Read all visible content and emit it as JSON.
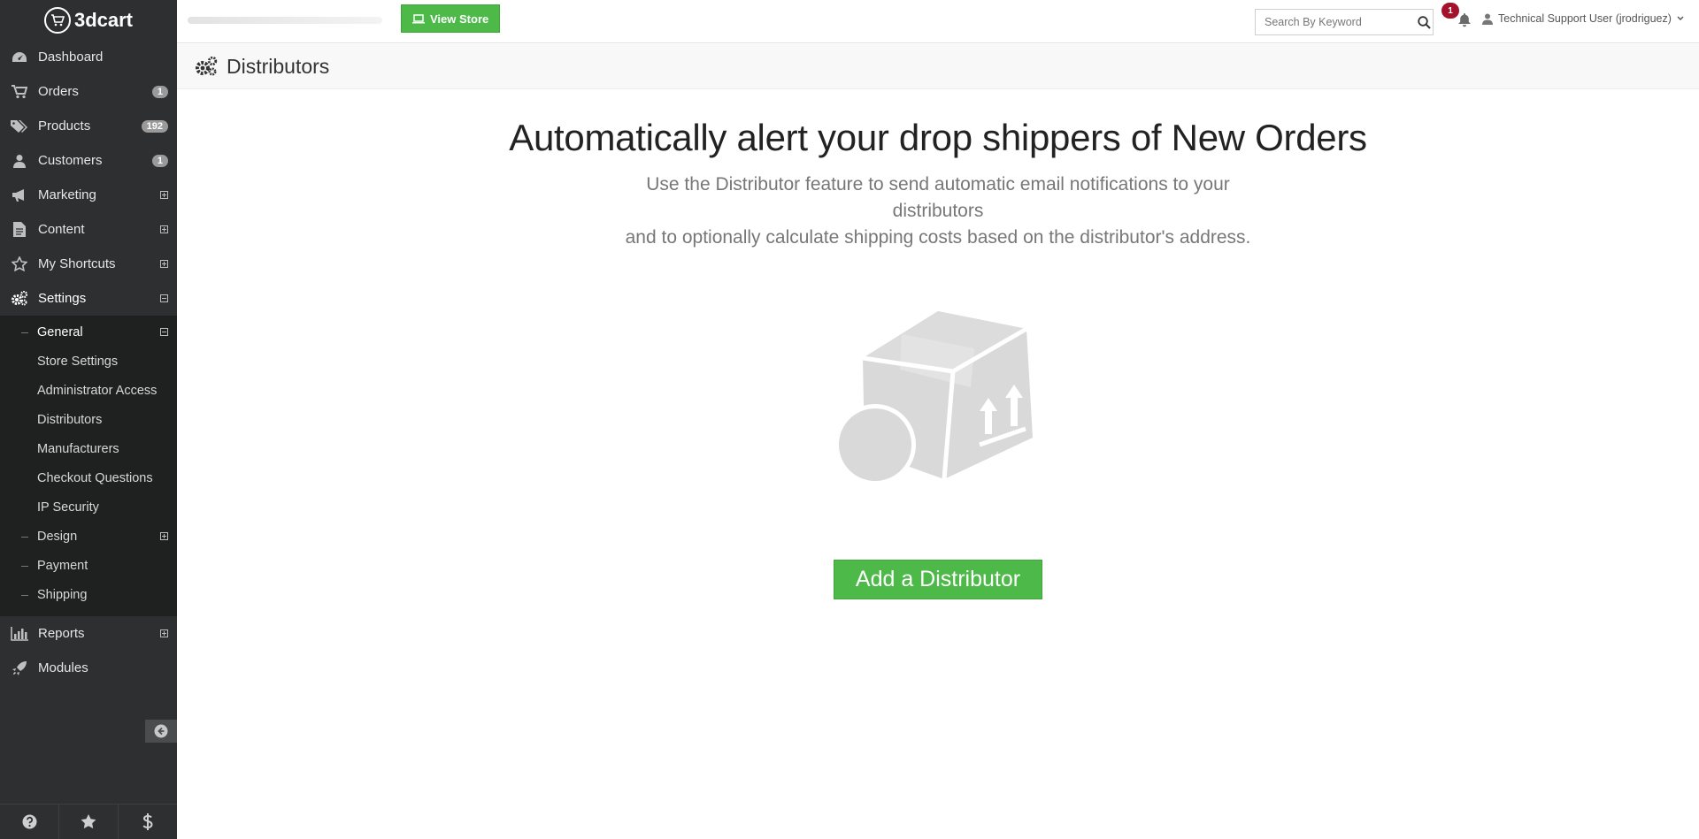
{
  "brand": {
    "logo_text": "3dcart"
  },
  "sidebar": {
    "items": [
      {
        "label": "Dashboard",
        "icon": "dashboard-icon"
      },
      {
        "label": "Orders",
        "badge": "1",
        "icon": "cart-icon"
      },
      {
        "label": "Products",
        "badge": "192",
        "icon": "tags-icon"
      },
      {
        "label": "Customers",
        "badge": "1",
        "icon": "user-icon"
      },
      {
        "label": "Marketing",
        "icon": "bullhorn-icon",
        "toggle": "expand"
      },
      {
        "label": "Content",
        "icon": "document-icon",
        "toggle": "expand"
      },
      {
        "label": "My Shortcuts",
        "icon": "star-icon",
        "toggle": "expand"
      },
      {
        "label": "Settings",
        "icon": "gears-icon",
        "toggle": "collapse"
      }
    ],
    "settings_submenu": {
      "general_label": "General",
      "items": [
        "Store Settings",
        "Administrator Access",
        "Distributors",
        "Manufacturers",
        "Checkout Questions",
        "IP Security"
      ],
      "design_label": "Design",
      "payment_label": "Payment",
      "shipping_label": "Shipping"
    },
    "after_items": [
      {
        "label": "Reports",
        "icon": "bar-chart-icon",
        "toggle": "expand"
      },
      {
        "label": "Modules",
        "icon": "rocket-icon"
      }
    ],
    "footer_icons": [
      "help-icon",
      "star-icon",
      "dollar-icon"
    ]
  },
  "topbar": {
    "view_store_label": "View Store",
    "search_placeholder": "Search By Keyword",
    "notification_count": "1",
    "user_label": "Technical Support User (jrodriguez)"
  },
  "page": {
    "title": "Distributors",
    "headline": "Automatically alert your drop shippers of New Orders",
    "description_line1": "Use the Distributor feature to send automatic email notifications to your distributors",
    "description_line2": "and to optionally calculate shipping costs based on the distributor's address.",
    "cta_label": "Add a Distributor"
  },
  "colors": {
    "sidebar_bg": "#2d2f30",
    "submenu_bg": "#1f2020",
    "accent_green": "#4cb949",
    "notification_red": "#a3122a",
    "illustration_gray": "#d9d9d9"
  }
}
